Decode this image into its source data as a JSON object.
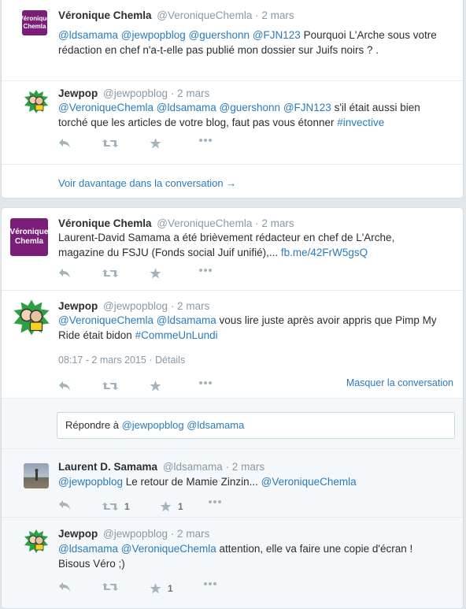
{
  "icons": {
    "reply": "reply-icon",
    "retweet": "retweet-icon",
    "favorite": "star-icon",
    "more": "more-icon"
  },
  "colors": {
    "link": "#2b7bb9",
    "muted": "#8899a6",
    "background": "#e1e8ed"
  },
  "thread1": {
    "tweet1": {
      "avatar_text": [
        "Véronique",
        "Chemla"
      ],
      "name": "Véronique Chemla",
      "screen_name": "@VeroniqueChemla",
      "date": "· 2 mars",
      "text": {
        "m1": "@ldsamama",
        "m2": "@jewpopblog",
        "m3": "@guershonn",
        "m4": "@FJN123",
        "line1_rest": "Pourquoi L'Arche sous votre",
        "line2": "rédaction en chef n'a-t-elle pas publié mon dossier sur Juifs noirs ? ."
      }
    },
    "tweet2": {
      "name": "Jewpop",
      "screen_name": "@jewpopblog",
      "date": "· 2 mars",
      "text": {
        "m1": "@VeroniqueChemla",
        "m2": "@ldsamama",
        "m3": "@guershonn",
        "m4": "@FJN123",
        "line1_rest": "s'il était aussi bien",
        "line2": "torché que les articles de votre blog, faut pas vous étonner",
        "hashtag": "#invective"
      }
    },
    "more_link": "Voir davantage dans la conversation →"
  },
  "thread2": {
    "tweet1": {
      "avatar_text": [
        "Véronique",
        "Chemla"
      ],
      "name": "Véronique Chemla",
      "screen_name": "@VeroniqueChemla",
      "date": "· 2 mars",
      "text": {
        "line1": "Laurent-David Samama a été brièvement rédacteur en chef de L'Arche,",
        "line2": "magazine du FSJU (Fonds social Juif unifié),...",
        "link": "fb.me/42FrW5gsQ"
      }
    },
    "tweet2": {
      "name": "Jewpop",
      "screen_name": "@jewpopblog",
      "date": "· 2 mars",
      "text": {
        "m1": "@VeroniqueChemla",
        "m2": "@ldsamama",
        "line1_rest": "vous lire juste après avoir appris que Pimp My",
        "line2": "Ride était bidon",
        "hashtag": "#CommeUnLundi"
      },
      "timestamp": "08:17 - 2 mars 2015",
      "details": "· Détails",
      "hide_conversation": "Masquer la conversation"
    },
    "reply_box": {
      "prefix": "Répondre à",
      "m1": "@jewpopblog",
      "m2": "@ldsamama"
    },
    "tweet3": {
      "name": "Laurent D. Samama",
      "screen_name": "@ldsamama",
      "date": "· 2 mars",
      "text": {
        "m1": "@jewpopblog",
        "middle": "Le retour de Mamie Zinzin...",
        "m2": "@VeroniqueChemla"
      },
      "retweets": "1",
      "favorites": "1"
    },
    "tweet4": {
      "name": "Jewpop",
      "screen_name": "@jewpopblog",
      "date": "· 2 mars",
      "text": {
        "m1": "@ldsamama",
        "m2": "@VeroniqueChemla",
        "line1_rest": "attention, elle va faire une copie d'écran !",
        "line2": "Bisous Véro ;)"
      },
      "favorites": "1"
    }
  }
}
